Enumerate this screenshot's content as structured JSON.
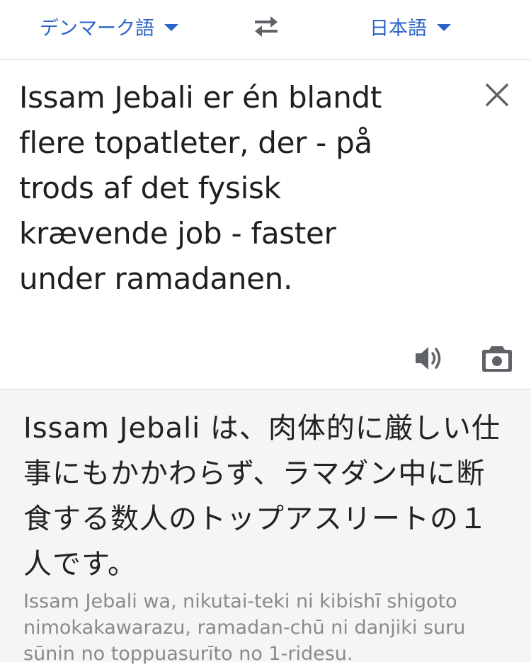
{
  "language_bar": {
    "source_language": "デンマーク語",
    "target_language": "日本語",
    "accent_color": "#2a64c8"
  },
  "input": {
    "source_text": "Issam Jebali er én blandt\nflere topatleter, der - på\ntrods af det fysisk\nkrævende job - faster\nunder ramadanen."
  },
  "icons": {
    "swap": "swap-arrows-icon",
    "clear": "close-icon",
    "speaker": "speaker-icon",
    "camera": "camera-icon"
  },
  "output": {
    "translation": "Issam Jebali は、肉体的に厳しい仕事にもかかわらず、ラマダン中に断食する数人のトップアスリートの１人です。",
    "romanization": "Issam Jebali wa, nikutai-teki ni kibishī shigoto nimokakawarazu, ramadan-chū ni danjiki suru sūnin no toppuasurīto no 1-ridesu."
  }
}
